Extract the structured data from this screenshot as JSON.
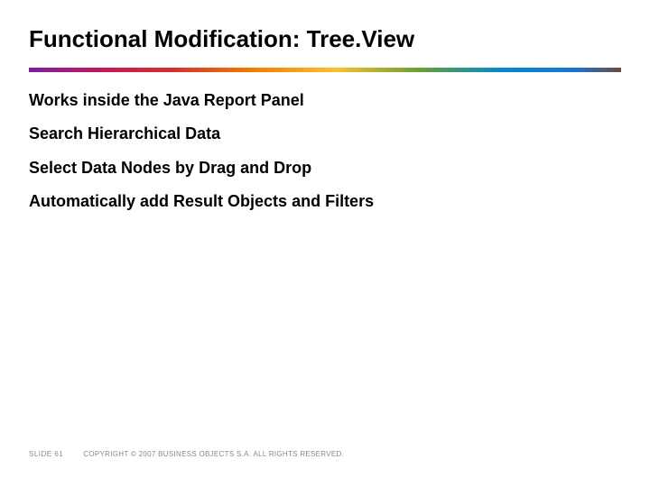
{
  "title": "Functional Modification: Tree.View",
  "bullets": [
    "Works inside the Java Report Panel",
    "Search Hierarchical Data",
    "Select Data Nodes by Drag and Drop",
    "Automatically add Result Objects and Filters"
  ],
  "footer": {
    "slide_label": "SLIDE 61",
    "copyright": "COPYRIGHT © 2007 BUSINESS OBJECTS S.A. ALL RIGHTS RESERVED."
  }
}
